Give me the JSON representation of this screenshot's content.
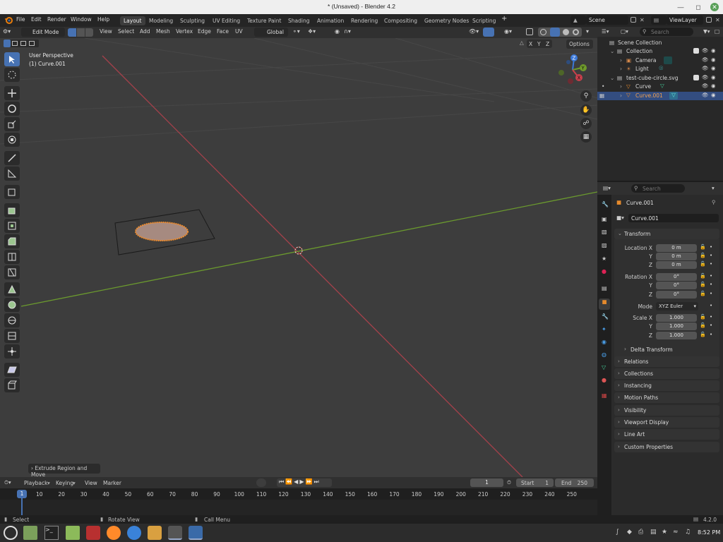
{
  "window": {
    "title": "* (Unsaved) - Blender 4.2"
  },
  "menus": [
    "File",
    "Edit",
    "Render",
    "Window",
    "Help"
  ],
  "workspaces": [
    {
      "label": "Layout",
      "active": true
    },
    {
      "label": "Modeling"
    },
    {
      "label": "Sculpting"
    },
    {
      "label": "UV Editing"
    },
    {
      "label": "Texture Paint"
    },
    {
      "label": "Shading"
    },
    {
      "label": "Animation"
    },
    {
      "label": "Rendering"
    },
    {
      "label": "Compositing"
    },
    {
      "label": "Geometry Nodes"
    },
    {
      "label": "Scripting"
    }
  ],
  "scene": {
    "name": "Scene",
    "view_layer": "ViewLayer"
  },
  "header3d": {
    "mode": "Edit Mode",
    "menus": [
      "View",
      "Select",
      "Add",
      "Mesh",
      "Vertex",
      "Edge",
      "Face",
      "UV"
    ],
    "orientation": "Global",
    "options_label": "Options",
    "axes": [
      "X",
      "Y",
      "Z"
    ]
  },
  "viewport": {
    "perspective_label": "User Perspective",
    "object_label": "(1) Curve.001",
    "last_operator": "Extrude Region and Move",
    "gizmo_axes": [
      "X",
      "Y",
      "Z"
    ]
  },
  "outliner": {
    "search_placeholder": "Search",
    "rows": [
      {
        "label": "Scene Collection"
      },
      {
        "label": "Collection"
      },
      {
        "label": "Camera"
      },
      {
        "label": "Light"
      },
      {
        "label": "test-cube-circle.svg"
      },
      {
        "label": "Curve"
      },
      {
        "label": "Curve.001",
        "selected": true
      }
    ]
  },
  "properties": {
    "search_placeholder": "Search",
    "object_name": "Curve.001",
    "datablock_name": "Curve.001",
    "transform_label": "Transform",
    "location": {
      "label": "Location X",
      "y_label": "Y",
      "z_label": "Z",
      "x": "0 m",
      "y": "0 m",
      "z": "0 m"
    },
    "rotation": {
      "label": "Rotation X",
      "y_label": "Y",
      "z_label": "Z",
      "x": "0°",
      "y": "0°",
      "z": "0°"
    },
    "mode": {
      "label": "Mode",
      "value": "XYZ Euler"
    },
    "scale": {
      "label": "Scale X",
      "y_label": "Y",
      "z_label": "Z",
      "x": "1.000",
      "y": "1.000",
      "z": "1.000"
    },
    "delta_transform": "Delta Transform",
    "panels": [
      "Relations",
      "Collections",
      "Instancing",
      "Motion Paths",
      "Visibility",
      "Viewport Display",
      "Line Art",
      "Custom Properties"
    ]
  },
  "timeline": {
    "menus": [
      "Playback",
      "Keying",
      "View",
      "Marker"
    ],
    "current_frame": "1",
    "start_label": "Start",
    "start": "1",
    "end_label": "End",
    "end": "250",
    "ruler": [
      "1",
      "10",
      "20",
      "30",
      "40",
      "50",
      "60",
      "70",
      "80",
      "90",
      "100",
      "110",
      "120",
      "130",
      "140",
      "150",
      "160",
      "170",
      "180",
      "190",
      "200",
      "210",
      "220",
      "230",
      "240",
      "250"
    ]
  },
  "statusbar": {
    "select": "Select",
    "rotate": "Rotate View",
    "call_menu": "Call Menu",
    "version": "4.2.0"
  },
  "taskbar": {
    "clock": "8:52 PM"
  },
  "colors": {
    "accent": "#4772b3",
    "x_axis": "#a5414b",
    "y_axis": "#6b9a2e",
    "selection": "#f28d2c"
  }
}
